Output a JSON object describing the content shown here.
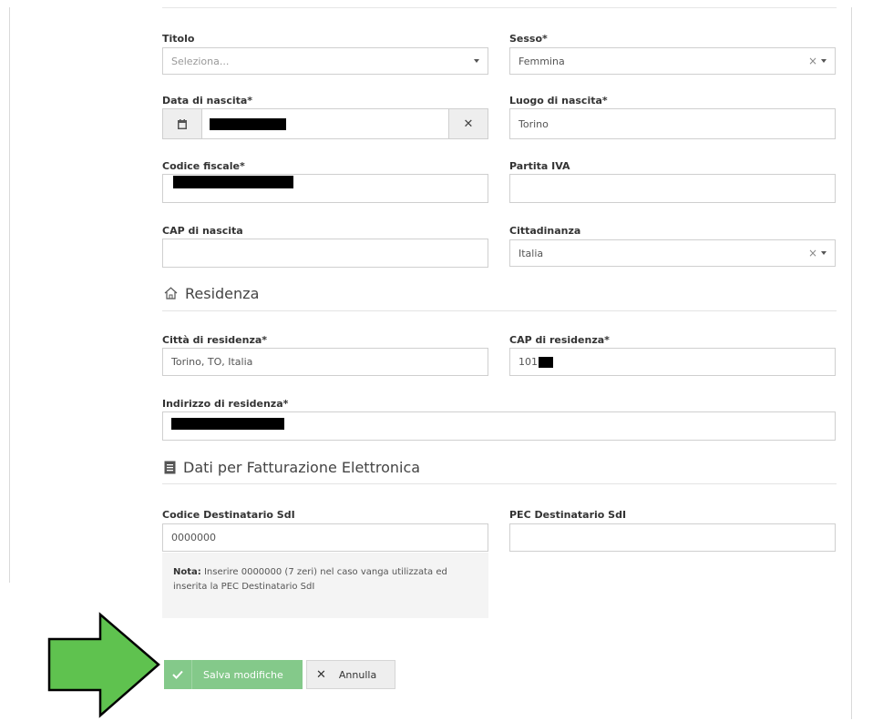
{
  "form": {
    "titolo": {
      "label": "Titolo",
      "placeholder": "Seleziona..."
    },
    "sesso": {
      "label": "Sesso*",
      "value": "Femmina"
    },
    "data_nascita": {
      "label": "Data di nascita*"
    },
    "luogo_nascita": {
      "label": "Luogo di nascita*",
      "value": "Torino"
    },
    "codice_fiscale": {
      "label": "Codice fiscale*"
    },
    "partita_iva": {
      "label": "Partita IVA",
      "value": ""
    },
    "cap_nascita": {
      "label": "CAP di nascita",
      "value": ""
    },
    "cittadinanza": {
      "label": "Cittadinanza",
      "value": "Italia"
    }
  },
  "residenza": {
    "title": "Residenza",
    "citta": {
      "label": "Città di residenza*",
      "value": "Torino, TO, Italia"
    },
    "cap": {
      "label": "CAP di residenza*",
      "value": "101"
    },
    "indirizzo": {
      "label": "Indirizzo di residenza*"
    }
  },
  "fatturazione": {
    "title": "Dati per Fatturazione Elettronica",
    "codice": {
      "label": "Codice Destinatario SdI",
      "value": "0000000"
    },
    "pec": {
      "label": "PEC Destinatario SdI",
      "value": ""
    },
    "nota_bold": "Nota:",
    "nota_text": " Inserire 0000000 (7 zeri) nel caso vanga utilizzata ed inserita la PEC Destinatario SdI"
  },
  "buttons": {
    "save": "Salva modifiche",
    "cancel": "Annulla"
  },
  "colors": {
    "arrow": "#5fc24f",
    "save": "#84c98a"
  }
}
